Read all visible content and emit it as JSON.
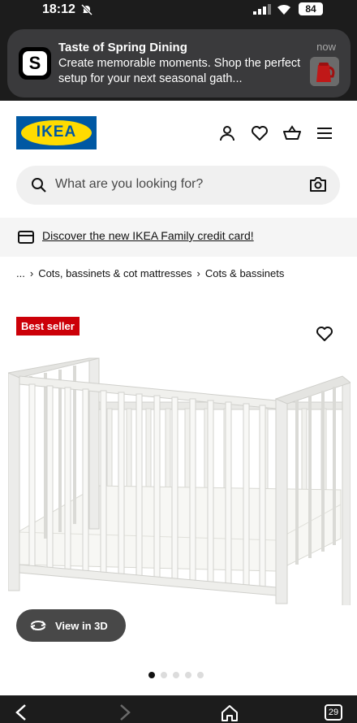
{
  "status_bar": {
    "time": "18:12",
    "battery": "84"
  },
  "notification": {
    "app_letter": "S",
    "title": "Taste of Spring Dining",
    "body": "Create memorable moments. Shop the perfect setup for your next seasonal gath...",
    "time": "now"
  },
  "header": {
    "logo": "IKEA"
  },
  "search": {
    "placeholder": "What are you looking for?"
  },
  "banner": {
    "link": "Discover the new IKEA Family credit card!"
  },
  "breadcrumb": {
    "ellipsis": "...",
    "items": [
      "Cots, bassinets & cot mattresses",
      "Cots & bassinets"
    ]
  },
  "product": {
    "badge": "Best seller",
    "view3d_label": "View in 3D",
    "image_count": 5,
    "active_image": 1
  },
  "browser": {
    "tab_count": "29"
  },
  "colors": {
    "ikea_blue": "#0058a3",
    "ikea_yellow": "#ffdb00",
    "badge_red": "#cc0008"
  }
}
